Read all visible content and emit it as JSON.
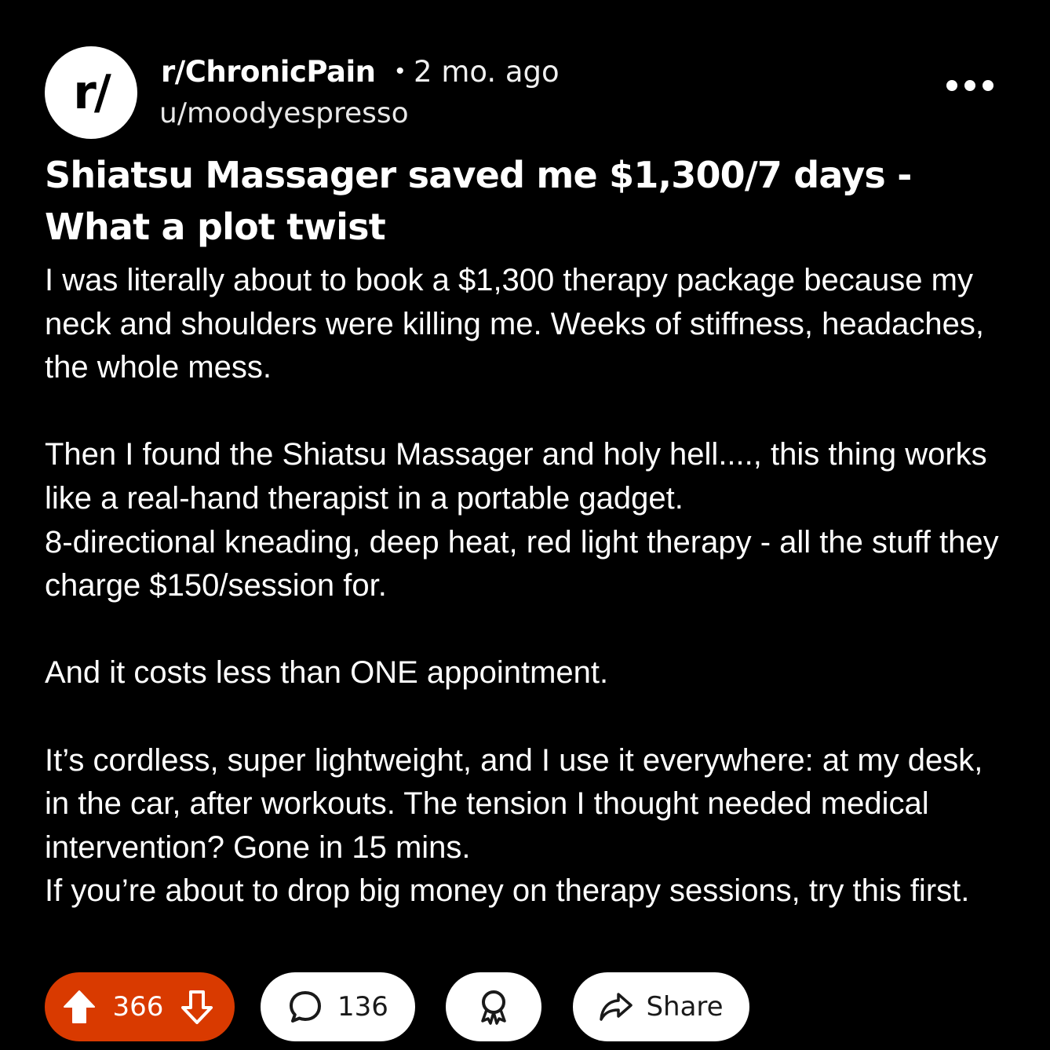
{
  "post": {
    "avatar_text": "r/",
    "subreddit": "r/ChronicPain",
    "separator": "•",
    "age": "2 mo. ago",
    "username": "u/moodyespresso",
    "title": "Shiatsu Massager saved me $1,300/7 days - What a plot twist",
    "body": "I was literally about to book a $1,300 therapy package because my neck and shoulders were killing me. Weeks of stiffness, headaches, the whole mess.\n\nThen I found the Shiatsu Massager and holy hell...., this thing works like a real-hand therapist in a portable gadget.\n8-directional kneading, deep heat, red light therapy - all the stuff they charge $150/session for.\n\nAnd it costs less than ONE appointment.\n\nIt’s cordless, super lightweight, and I use it everywhere: at my desk, in the car, after workouts. The tension I thought needed medical intervention? Gone in 15 mins.\nIf you’re about to drop big money on therapy sessions, try this first."
  },
  "actions": {
    "votes": "366",
    "comments": "136",
    "share_label": "Share"
  },
  "icons": {
    "more": "more-options-icon",
    "upvote": "upvote-arrow-icon",
    "downvote": "downvote-arrow-icon",
    "comment": "comment-bubble-icon",
    "award": "award-icon",
    "share": "share-arrow-icon"
  },
  "colors": {
    "background": "#000000",
    "vote_pill": "#d93a00",
    "pill": "#ffffff",
    "text": "#ffffff"
  }
}
